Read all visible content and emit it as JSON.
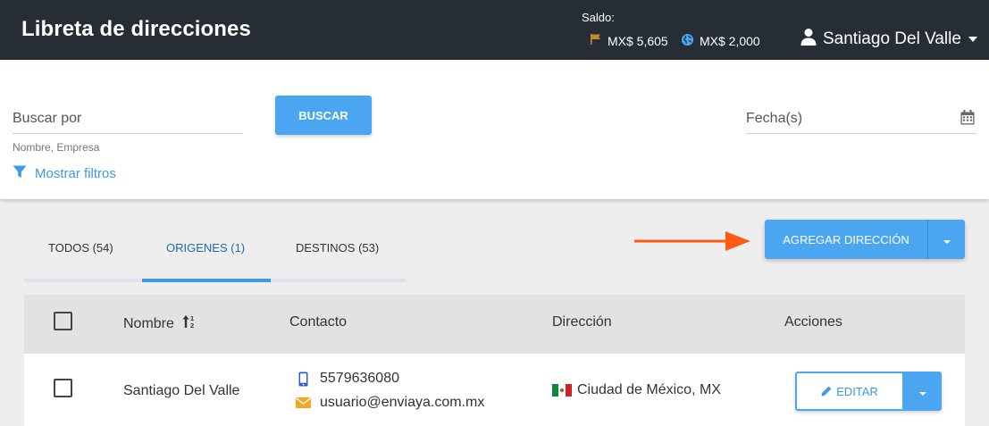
{
  "header": {
    "title": "Libreta de direcciones",
    "saldo_label": "Saldo:",
    "balance_local": "MX$ 5,605",
    "balance_intl": "MX$ 2,000",
    "user_name": "Santiago Del Valle",
    "icons": {
      "local": "flag-icon",
      "intl": "globe-icon",
      "user": "user-icon"
    }
  },
  "search": {
    "placeholder": "Buscar por",
    "hint": "Nombre, Empresa",
    "button_label": "BUSCAR",
    "filters_label": "Mostrar filtros",
    "date_placeholder": "Fecha(s)"
  },
  "tabs": [
    {
      "label": "TODOS (54)",
      "active": false
    },
    {
      "label": "ORIGENES (1)",
      "active": true
    },
    {
      "label": "DESTINOS (53)",
      "active": false
    }
  ],
  "actions": {
    "add_label": "AGREGAR DIRECCIÓN"
  },
  "table": {
    "columns": [
      "Nombre",
      "Contacto",
      "Dirección",
      "Acciones"
    ],
    "rows": [
      {
        "name": "Santiago Del Valle",
        "phone": "5579636080",
        "email": "usuario@enviaya.com.mx",
        "address": "Ciudad de México, MX",
        "action_label": "EDITAR"
      }
    ]
  },
  "colors": {
    "topbar": "#262d35",
    "primary": "#4aa6f0",
    "link": "#3c9ae6",
    "arrow": "#ff5b14",
    "tab_active": "#1e6aa8"
  }
}
